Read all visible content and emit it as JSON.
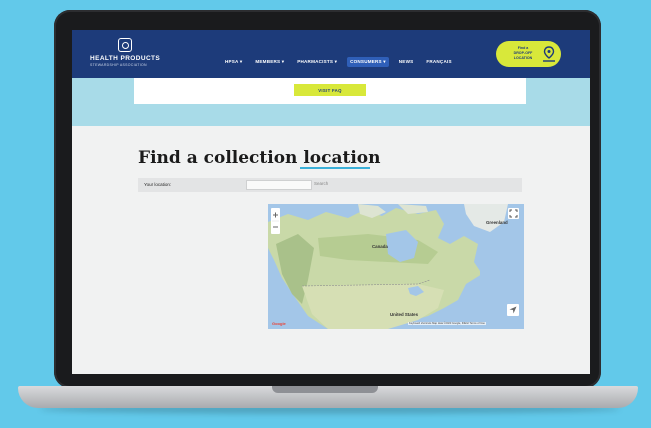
{
  "org": {
    "name": "HEALTH PRODUCTS",
    "subtitle": "STEWARDSHIP ASSOCIATION"
  },
  "nav": {
    "items": [
      {
        "label": "HPSA ▾",
        "active": false
      },
      {
        "label": "MEMBERS ▾",
        "active": false
      },
      {
        "label": "PHARMACISTS ▾",
        "active": false
      },
      {
        "label": "CONSUMERS ▾",
        "active": true
      },
      {
        "label": "NEWS",
        "active": false
      },
      {
        "label": "FRANÇAIS",
        "active": false
      }
    ],
    "dropoff_label": "Find a\nDROP-OFF\nLOCATION"
  },
  "faq": {
    "button_label": "VISIT FAQ"
  },
  "page": {
    "title": "Find a collection location"
  },
  "search": {
    "label": "Your location:",
    "value": "",
    "button_label": "Search"
  },
  "map": {
    "labels": {
      "canada": "Canada",
      "us": "United States",
      "greenland": "Greenland"
    },
    "google": "Google",
    "attribution": "Keyboard shortcuts   Map data ©2023 Google, INEGI   Terms of Use"
  },
  "colors": {
    "nav_bg": "#1d3b7a",
    "accent_lime": "#d8e83a",
    "band": "#a8dbe8",
    "page_bg": "#62c9ea",
    "active_nav": "#2f5fb8"
  }
}
